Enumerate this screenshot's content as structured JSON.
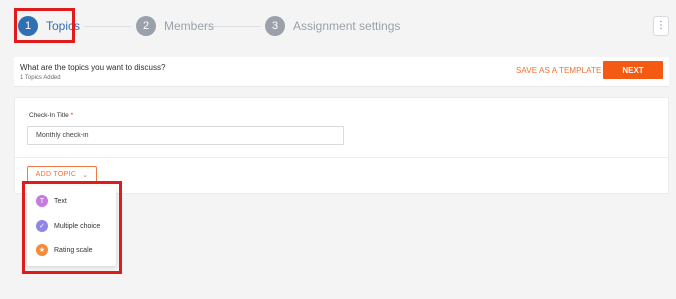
{
  "stepper": {
    "steps": [
      {
        "number": "1",
        "label": "Topics",
        "state": "active"
      },
      {
        "number": "2",
        "label": "Members",
        "state": "inactive"
      },
      {
        "number": "3",
        "label": "Assignment settings",
        "state": "inactive"
      }
    ],
    "more_icon": "vertical-dots-icon",
    "more_glyph": "⋮"
  },
  "header": {
    "question": "What are the topics you want to discuss?",
    "topics_added": "1 Topics Added",
    "save_template_label": "SAVE AS A TEMPLATE",
    "next_label": "NEXT"
  },
  "card": {
    "field_label": "Check-In Title",
    "required_mark": "*",
    "title_value": "Monthly check-in",
    "add_topic_label": "ADD TOPIC",
    "add_topic_icon": "chevron-down-icon",
    "add_topic_glyph": "⌄"
  },
  "topic_menu": {
    "items": [
      {
        "label": "Text",
        "icon": "text-type-icon",
        "glyph": "T",
        "color": "#c77adf"
      },
      {
        "label": "Multiple choice",
        "icon": "checkmark-icon",
        "glyph": "✓",
        "color": "#8f86e6"
      },
      {
        "label": "Rating scale",
        "icon": "star-icon",
        "glyph": "★",
        "color": "#f58a3a"
      }
    ]
  },
  "colors": {
    "accent_blue": "#2f6fb3",
    "accent_orange": "#f55a12",
    "highlight_red": "#e01b1b"
  }
}
